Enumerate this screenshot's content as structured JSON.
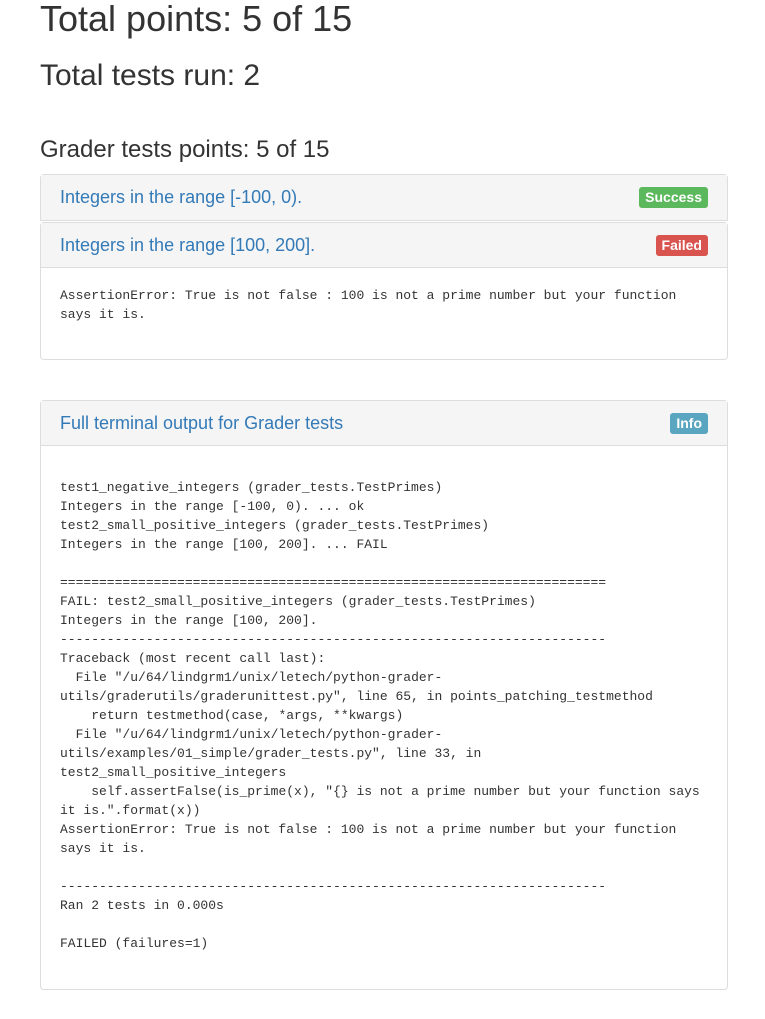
{
  "summary": {
    "total_points": "Total points: 5 of 15",
    "total_tests": "Total tests run: 2",
    "grader_points": "Grader tests points: 5 of 15"
  },
  "tests": [
    {
      "title": "Integers in the range [-100, 0).",
      "status": "Success",
      "status_color": "#5cb85c"
    },
    {
      "title": "Integers in the range [100, 200].",
      "status": "Failed",
      "status_color": "#d9534f",
      "output": "AssertionError: True is not false : 100 is not a prime number but your function\nsays it is."
    }
  ],
  "terminal": {
    "title": "Full terminal output for Grader tests",
    "status": "Info",
    "status_color": "#5bc0de",
    "output": "test1_negative_integers (grader_tests.TestPrimes)\nIntegers in the range [-100, 0). ... ok\ntest2_small_positive_integers (grader_tests.TestPrimes)\nIntegers in the range [100, 200]. ... FAIL\n\n======================================================================\nFAIL: test2_small_positive_integers (grader_tests.TestPrimes)\nIntegers in the range [100, 200].\n----------------------------------------------------------------------\nTraceback (most recent call last):\n  File \"/u/64/lindgrm1/unix/letech/python-grader-\nutils/graderutils/graderunittest.py\", line 65, in points_patching_testmethod\n    return testmethod(case, *args, **kwargs)\n  File \"/u/64/lindgrm1/unix/letech/python-grader-\nutils/examples/01_simple/grader_tests.py\", line 33, in\ntest2_small_positive_integers\n    self.assertFalse(is_prime(x), \"{} is not a prime number but your function says\nit is.\".format(x))\nAssertionError: True is not false : 100 is not a prime number but your function\nsays it is.\n\n----------------------------------------------------------------------\nRan 2 tests in 0.000s\n\nFAILED (failures=1)"
  }
}
